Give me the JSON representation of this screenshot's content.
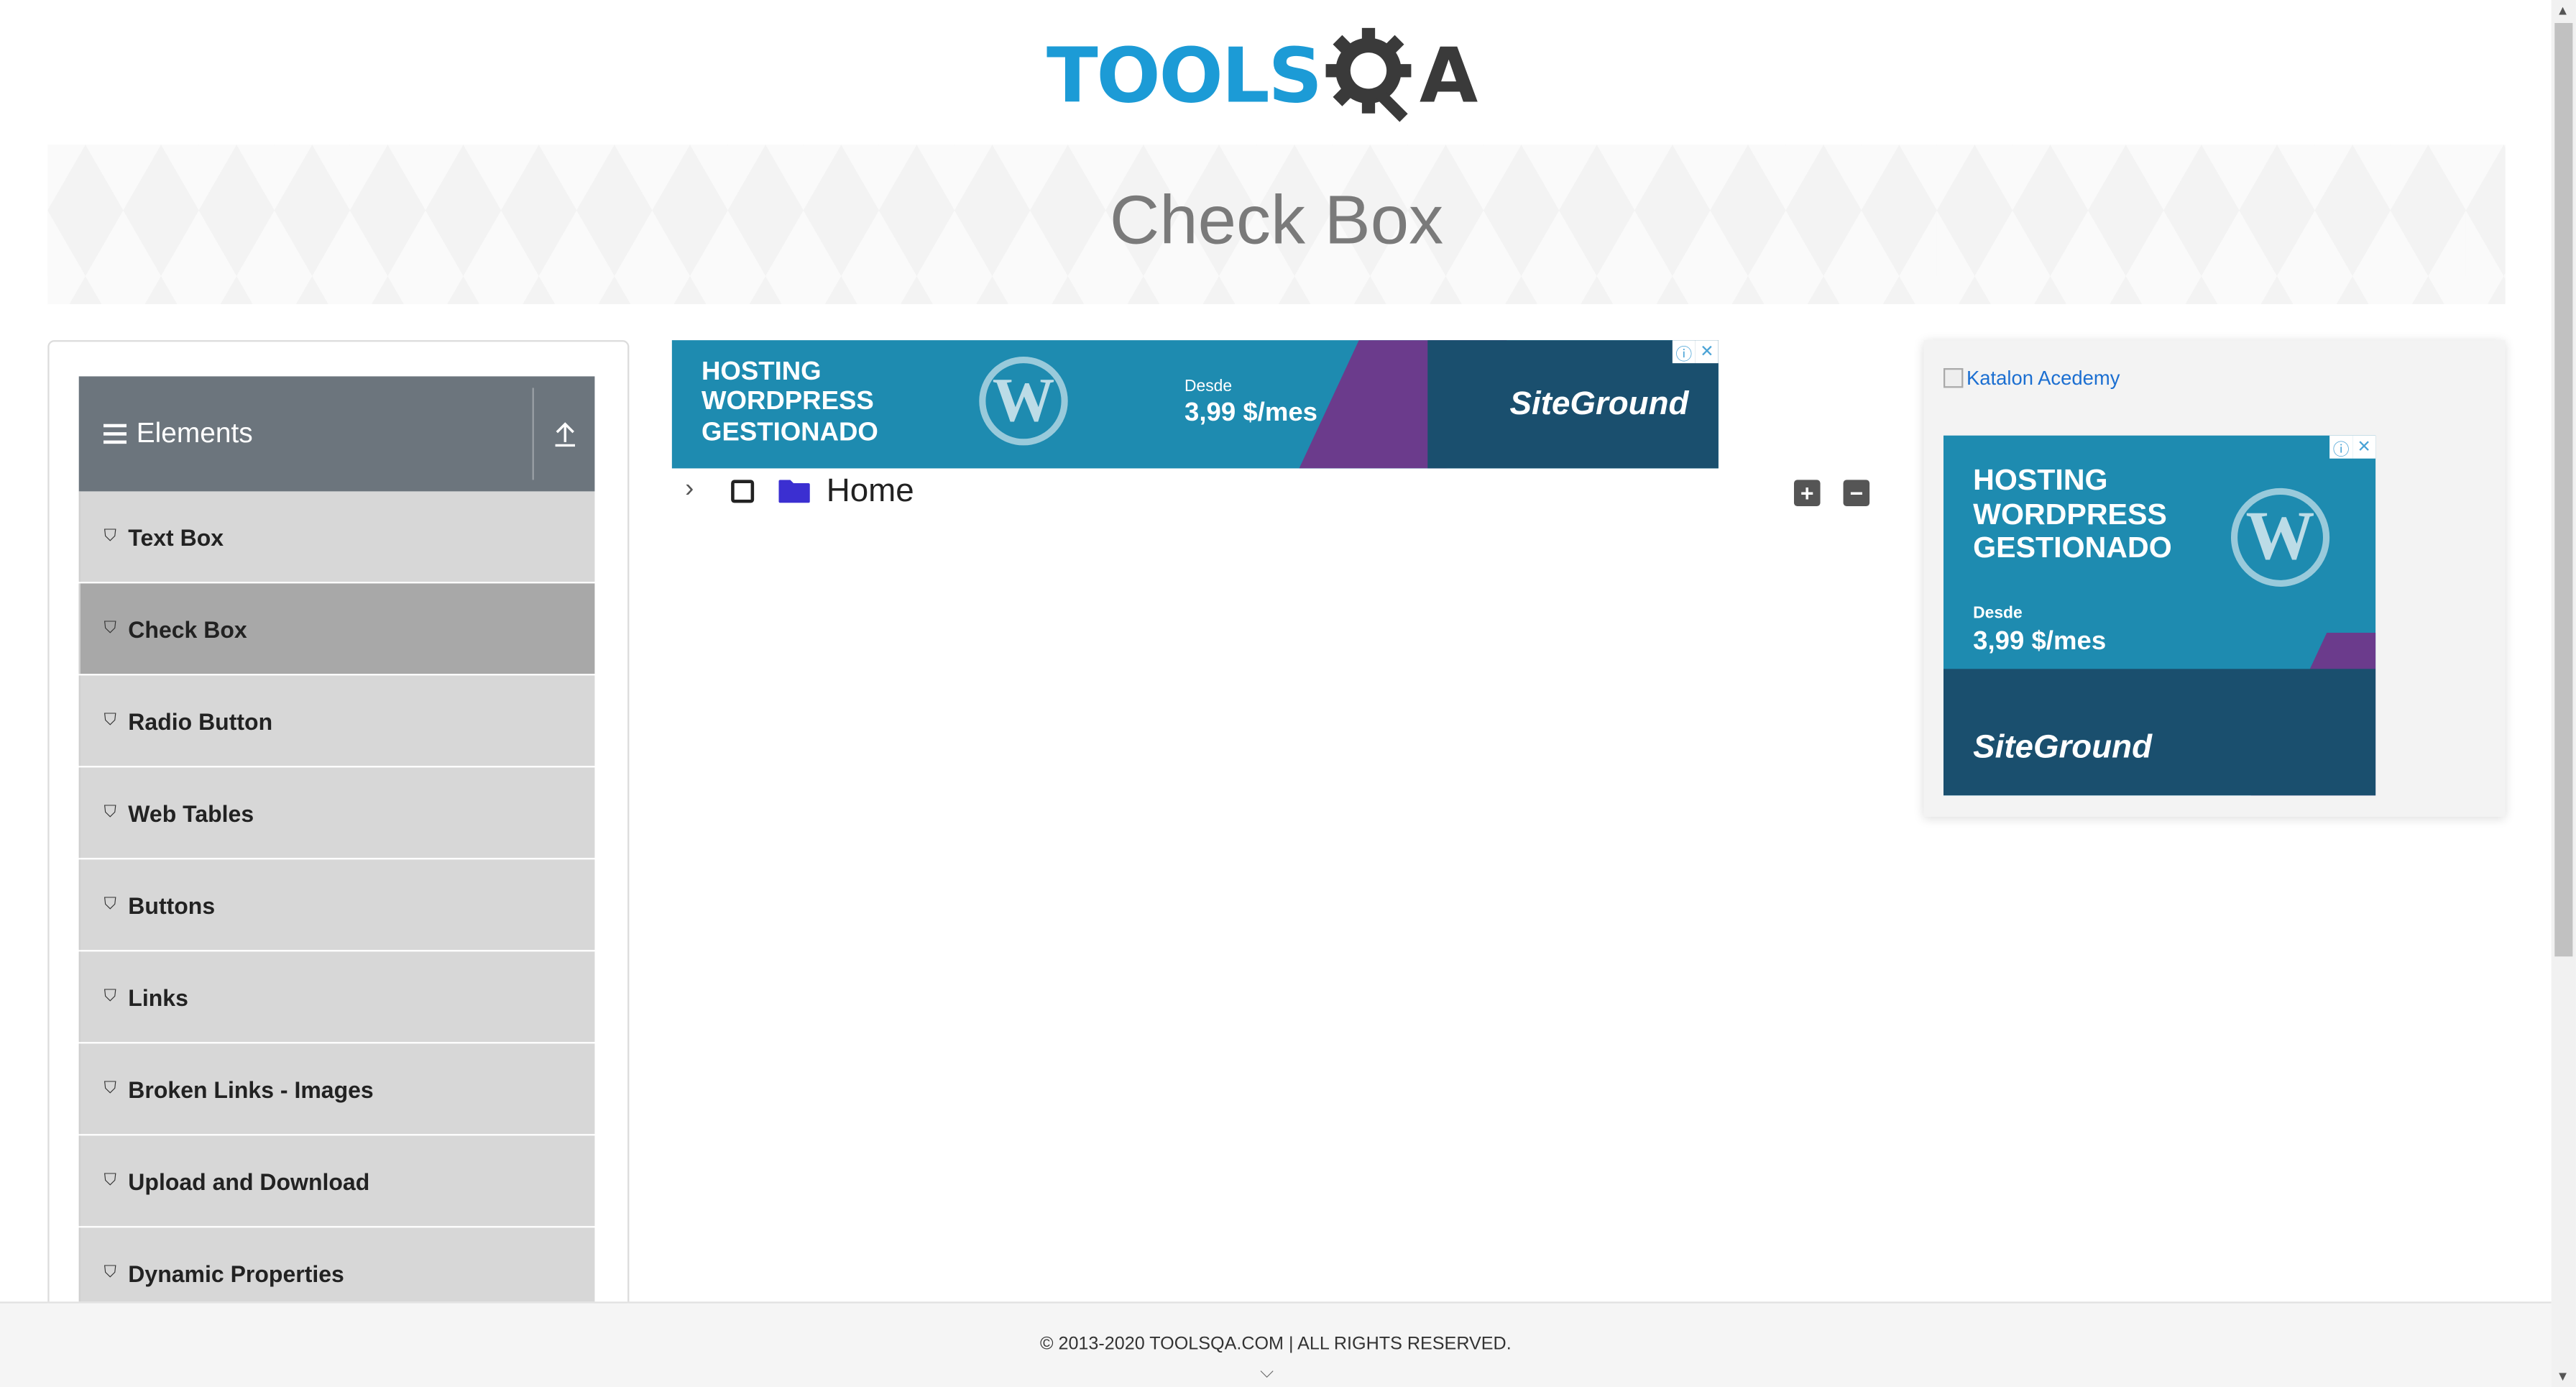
{
  "logo": {
    "text": "TOOLS",
    "text_after": "A",
    "alt": "TOOLSQA"
  },
  "banner": {
    "title": "Check Box"
  },
  "sidebar": {
    "group_title": "Elements",
    "items": [
      {
        "label": "Text Box",
        "active": false
      },
      {
        "label": "Check Box",
        "active": true
      },
      {
        "label": "Radio Button",
        "active": false
      },
      {
        "label": "Web Tables",
        "active": false
      },
      {
        "label": "Buttons",
        "active": false
      },
      {
        "label": "Links",
        "active": false
      },
      {
        "label": "Broken Links - Images",
        "active": false
      },
      {
        "label": "Upload and Download",
        "active": false
      },
      {
        "label": "Dynamic Properties",
        "active": false
      }
    ]
  },
  "ad_top": {
    "line1": "HOSTING",
    "line2": "WORDPRESS",
    "line3": "GESTIONADO",
    "desde": "Desde",
    "price": "3,99 $/mes",
    "brand": "SiteGround"
  },
  "tree": {
    "root_label": "Home",
    "expand_all": "+",
    "collapse_all": "−"
  },
  "right_panel": {
    "link_text": "Katalon Acedemy",
    "ad": {
      "line1": "HOSTING",
      "line2": "WORDPRESS",
      "line3": "GESTIONADO",
      "desde": "Desde",
      "price": "3,99 $/mes",
      "brand": "SiteGround"
    }
  },
  "footer": {
    "text": "© 2013-2020 TOOLSQA.COM | ALL RIGHTS RESERVED."
  },
  "colors": {
    "brand_blue": "#1c9bd6",
    "sidebar_header": "#6c757d",
    "menu_item": "#d7d7d7",
    "menu_active": "#a8a8a8"
  }
}
